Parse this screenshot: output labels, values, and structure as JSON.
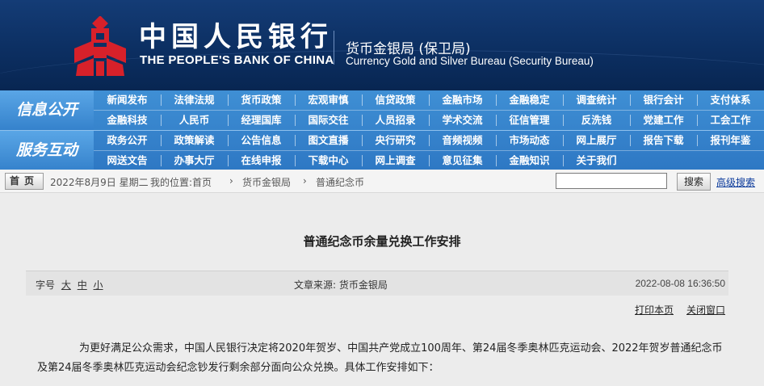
{
  "header": {
    "cn_name": "中国人民银行",
    "en_name": "THE PEOPLE'S BANK OF CHINA",
    "bureau_cn": "货币金银局 (保卫局)",
    "bureau_en": "Currency  Gold and Silver Bureau (Security Bureau)",
    "brand_color": "#d7212a",
    "bg_color": "#0c2f62"
  },
  "nav": {
    "section1": {
      "title": "信息公开",
      "row1": [
        "新闻发布",
        "法律法规",
        "货币政策",
        "宏观审慎",
        "信贷政策",
        "金融市场",
        "金融稳定",
        "调查统计",
        "银行会计",
        "支付体系"
      ],
      "row2": [
        "金融科技",
        "人民币",
        "经理国库",
        "国际交往",
        "人员招录",
        "学术交流",
        "征信管理",
        "反洗钱",
        "党建工作",
        "工会工作"
      ]
    },
    "section2": {
      "title": "服务互动",
      "row1": [
        "政务公开",
        "政策解读",
        "公告信息",
        "图文直播",
        "央行研究",
        "音频视频",
        "市场动态",
        "网上展厅",
        "报告下载",
        "报刊年鉴"
      ],
      "row2": [
        "网送文告",
        "办事大厅",
        "在线申报",
        "下载中心",
        "网上调查",
        "意见征集",
        "金融知识",
        "关于我们"
      ]
    }
  },
  "breadcrumb": {
    "home": "首页",
    "date": "2022年8月9日  星期二",
    "location": "我的位置:首页",
    "sep": "›",
    "level2": "货币金银局",
    "level3": "普通纪念币",
    "search_value": "",
    "search_button": "搜索",
    "advanced": "高级搜索"
  },
  "article": {
    "title": "普通纪念币余量兑换工作安排",
    "font_size_label": "字号",
    "font_large": "大",
    "font_medium": "中",
    "font_small": "小",
    "source": "文章来源: 货币金银局",
    "datetime": "2022-08-08  16:36:50",
    "print": "打印本页",
    "close": "关闭窗口",
    "body": "为更好满足公众需求，中国人民银行决定将2020年贺岁、中国共产党成立100周年、第24届冬季奥林匹克运动会、2022年贺岁普通纪念币及第24届冬季奥林匹克运动会纪念钞发行剩余部分面向公众兑换。具体工作安排如下："
  }
}
